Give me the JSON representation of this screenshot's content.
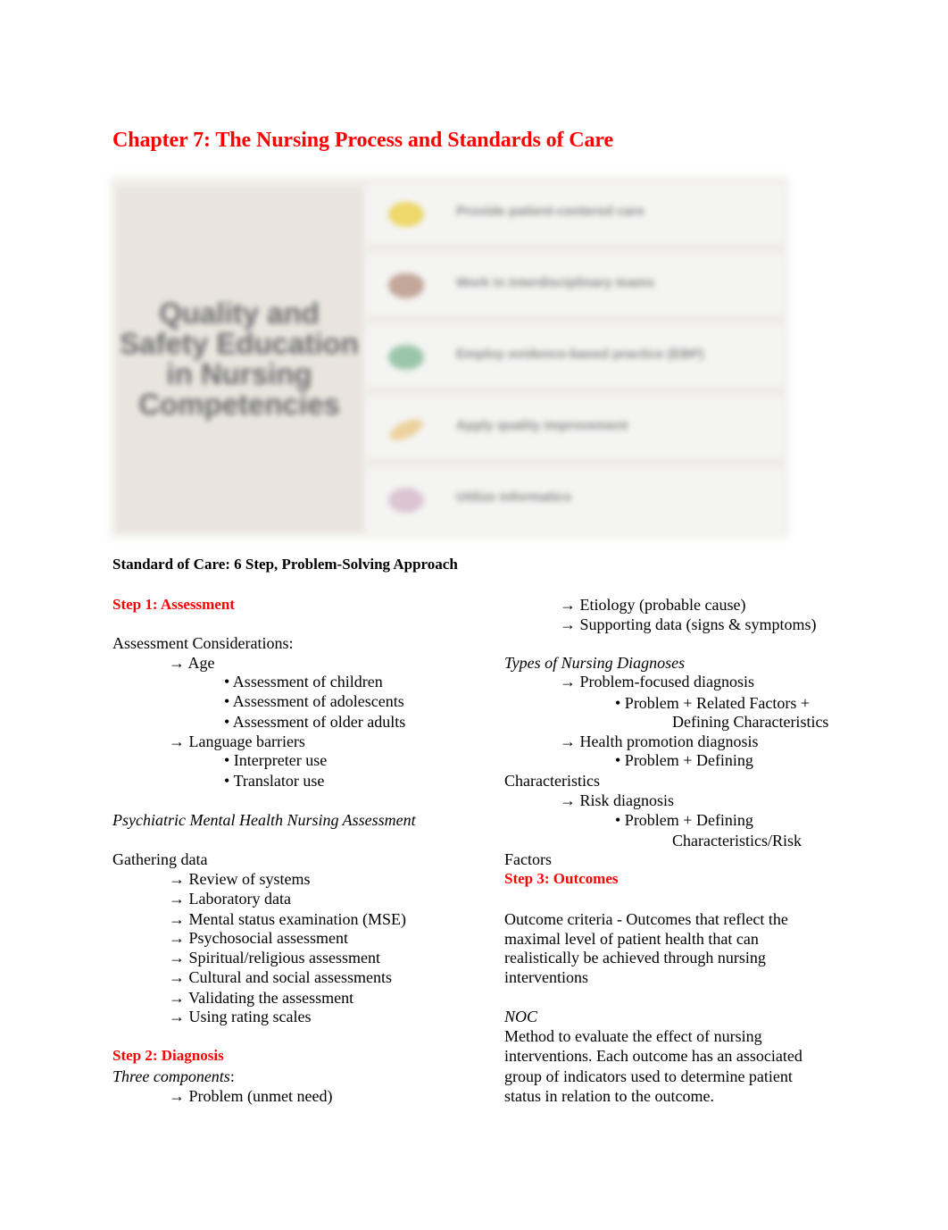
{
  "document": {
    "title": "Chapter 7: The Nursing Process and Standards of Care"
  },
  "infographic": {
    "title": "Quality and Safety Education in Nursing Competencies",
    "items": [
      {
        "label": "Provide patient-centered care",
        "icon": "sun-icon",
        "color": "#eed86a"
      },
      {
        "label": "Work in interdisciplinary teams",
        "icon": "team-icon",
        "color": "#c3a799"
      },
      {
        "label": "Employ evidence-based practice (EBP)",
        "icon": "evidence-icon",
        "color": "#9bc6aa"
      },
      {
        "label": "Apply quality improvement",
        "icon": "check-icon",
        "color": "#ecd29c"
      },
      {
        "label": "Utilize informatics",
        "icon": "informatics-icon",
        "color": "#dcc4d2"
      }
    ]
  },
  "section": {
    "heading": "Standard of Care: 6 Step, Problem-Solving Approach"
  },
  "left_column": {
    "step1_heading": "Step 1: Assessment",
    "considerations_label": "Assessment Considerations:",
    "age": "→ Age",
    "age_items": [
      "• Assessment of children",
      "• Assessment of adolescents",
      "• Assessment of older adults"
    ],
    "language": "→ Language barriers",
    "language_items": [
      "• Interpreter use",
      "• Translator use"
    ],
    "psych_heading": "Psychiatric Mental Health Nursing Assessment",
    "gathering_label": "Gathering data",
    "gathering_items": [
      "→  Review of systems",
      "→  Laboratory data",
      "→  Mental status examination (MSE)",
      "→  Psychosocial assessment",
      "→  Spiritual/religious assessment",
      "→  Cultural and social assessments",
      "→  Validating the assessment",
      "→  Using rating scales"
    ],
    "step2_heading": "Step 2: Diagnosis",
    "three_components": "Three components",
    "three_components_colon": ":",
    "problem_item": "→  Problem (unmet need)"
  },
  "right_column": {
    "etiology": "→ Etiology (probable cause)",
    "supporting": "→ Supporting data (signs & symptoms)",
    "types_heading": "Types of Nursing Diagnoses",
    "problem_focused": "→  Problem-focused diagnosis",
    "problem_focused_detail_1": "• Problem + Related Factors +",
    "problem_focused_detail_2": "Defining Characteristics",
    "health_promotion": "→  Health promotion diagnosis",
    "health_promotion_detail_1": "• Problem + Defining",
    "health_promotion_detail_2": "Characteristics",
    "risk": "→  Risk diagnosis",
    "risk_detail_1": "•  Problem + Defining",
    "risk_detail_2": "Characteristics/Risk",
    "risk_detail_3": "Factors",
    "step3_heading": "Step 3: Outcomes",
    "outcome_criteria": [
      "Outcome criteria - Outcomes that reflect the",
      "maximal level of patient health that can",
      "realistically be achieved through nursing",
      "interventions"
    ],
    "noc_heading": "NOC",
    "noc_text": [
      "Method to evaluate the effect of nursing",
      "interventions. Each outcome has an associated",
      "group of indicators used to determine patient",
      "status in relation to the outcome."
    ]
  }
}
